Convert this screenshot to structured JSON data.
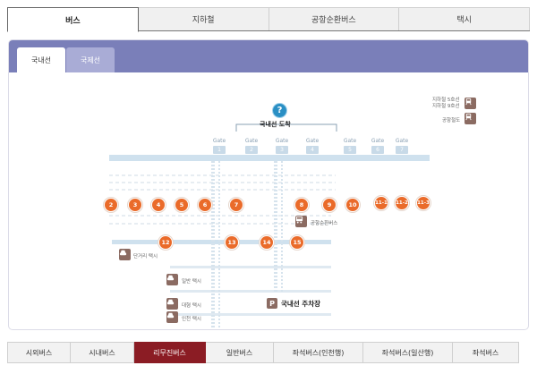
{
  "top_tabs": [
    {
      "label": "버스",
      "active": true
    },
    {
      "label": "지하철",
      "active": false
    },
    {
      "label": "공항순환버스",
      "active": false
    },
    {
      "label": "택시",
      "active": false
    }
  ],
  "sub_tabs": [
    {
      "label": "국내선",
      "active": true
    },
    {
      "label": "국제선",
      "active": false
    }
  ],
  "map": {
    "arrival_label": "국내선 도착",
    "gate_word": "Gate",
    "gates": [
      "1",
      "2",
      "3",
      "4",
      "5",
      "6",
      "7",
      "8"
    ],
    "stops_row1": [
      "2",
      "3",
      "4",
      "5",
      "6",
      "7",
      "8",
      "9",
      "10",
      "11-1",
      "11-2",
      "11-3"
    ],
    "stops_row2": [
      "12",
      "13",
      "14",
      "15"
    ],
    "labels": {
      "airport_shuttle": "공항순환버스",
      "group_taxi": "단거리 택시",
      "regular_taxi": "일반 택시",
      "large_taxi": "대형 택시",
      "incheon_taxi": "인천 택시",
      "parking": "국내선 주차장",
      "legend_subway": "지하철 5호선\n지하철 9호선",
      "legend_subway_a": "지하철 5호선",
      "legend_subway_b": "지하철 9호선",
      "legend_rail": "공항철도"
    },
    "colors": {
      "stop": "#ea6b2a",
      "road": "#cfe1ee",
      "icon": "#8b6b62",
      "info": "#2a8fc4"
    }
  },
  "bottom_tabs": [
    {
      "label": "시외버스",
      "active": false
    },
    {
      "label": "시내버스",
      "active": false
    },
    {
      "label": "리무진버스",
      "active": true
    },
    {
      "label": "일반버스",
      "active": false
    },
    {
      "label": "좌석버스(인천행)",
      "active": false
    },
    {
      "label": "좌석버스(일산행)",
      "active": false
    },
    {
      "label": "좌석버스",
      "active": false
    }
  ]
}
